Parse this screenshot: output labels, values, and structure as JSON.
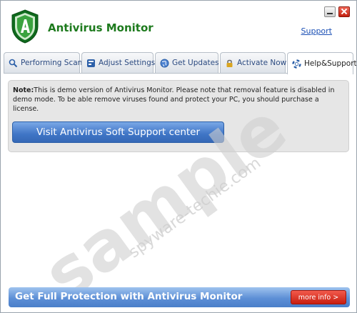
{
  "app": {
    "title": "Antivirus Monitor",
    "support_label": "Support"
  },
  "tabs": [
    {
      "label": "Performing Scan",
      "icon": "magnifier-icon"
    },
    {
      "label": "Adjust Settings",
      "icon": "settings-icon"
    },
    {
      "label": "Get Updates",
      "icon": "globe-icon"
    },
    {
      "label": "Activate Now",
      "icon": "lock-icon"
    },
    {
      "label": "Help&Support",
      "icon": "lifebuoy-icon",
      "active": true
    }
  ],
  "help": {
    "note_label": "Note:",
    "note_text": "This is demo version of Antivirus Monitor. Please note that removal feature is disabled in demo mode. To be able remove viruses found and protect your PC, you should purchase a license.",
    "visit_button": "Visit Antivirus Soft Support center"
  },
  "promo": {
    "text": "Get Full Protection with Antivirus Monitor",
    "more_info": "more info >"
  },
  "watermark": {
    "text": "sample",
    "url": "spyware-techie.com"
  },
  "colors": {
    "title_green": "#1d7a1d",
    "link_blue": "#1a4fb5",
    "button_blue": "#3f75c6",
    "promo_red": "#c81e10"
  }
}
